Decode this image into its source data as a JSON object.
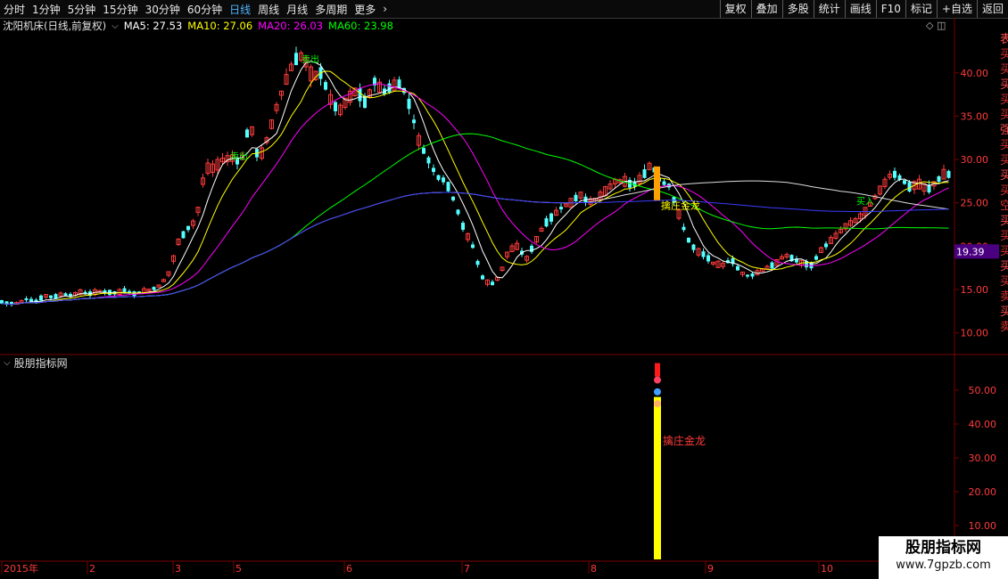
{
  "toolbar": {
    "periods": [
      "分时",
      "1分钟",
      "5分钟",
      "15分钟",
      "30分钟",
      "60分钟",
      "日线",
      "周线",
      "月线",
      "多周期",
      "更多"
    ],
    "active_index": 6,
    "more_arrow": "›",
    "actions": [
      "复权",
      "叠加",
      "多股",
      "统计",
      "画线",
      "F10",
      "标记",
      "+自选",
      "返回"
    ]
  },
  "info": {
    "stock_title": "沈阳机床(日线,前复权)",
    "ma5": "MA5: 27.53",
    "ma10": "MA10: 27.06",
    "ma20": "MA20: 26.03",
    "ma60": "MA60: 23.98",
    "icons": "◇ ◫"
  },
  "colors": {
    "up": "#ff3b3b",
    "down": "#54ffff",
    "ma5": "#ffffff",
    "ma10": "#ffff00",
    "ma20": "#ff00ff",
    "ma60": "#00ff00",
    "ma120": "#dcdcdc",
    "ma250": "#3b3bff",
    "grid": "#7a0000",
    "axis_text": "#ff3b3b",
    "price_tag_bg": "#4b0082"
  },
  "price_axis": {
    "ticks": [
      "40.00",
      "35.00",
      "30.00",
      "25.00",
      "20.00",
      "15.00",
      "10.00"
    ],
    "current_price": "19.39"
  },
  "annotations": {
    "sell_label": "卖出",
    "buy_label": "买入",
    "signal_label": "擒庄金龙"
  },
  "indicator": {
    "title": "股朋指标网",
    "ticks": [
      "50.00",
      "40.00",
      "30.00",
      "20.00",
      "10.00"
    ],
    "signal_label": "擒庄金龙"
  },
  "date_axis": {
    "labels": [
      "2015年",
      "2",
      "3",
      "5",
      "6",
      "7",
      "8",
      "9",
      "10"
    ]
  },
  "right_strip_text": [
    "表",
    "买",
    "买",
    "买",
    "买",
    "买",
    "强",
    "买",
    "买",
    "买",
    "买",
    "空",
    "买",
    "买",
    "买",
    "买",
    "买",
    "卖",
    "买",
    "卖"
  ],
  "watermark": {
    "line1": "股朋指标网",
    "line2": "www.7gpzb.com"
  },
  "chart_data": {
    "type": "candlestick",
    "price_range": [
      7.5,
      44.5
    ],
    "closing_trend": [
      [
        1,
        13.6
      ],
      [
        10,
        13.4
      ],
      [
        20,
        13.4
      ],
      [
        30,
        13.9
      ],
      [
        40,
        13.6
      ],
      [
        50,
        14.3
      ],
      [
        60,
        14.1
      ],
      [
        70,
        14.5
      ],
      [
        80,
        14.3
      ],
      [
        90,
        14.7
      ],
      [
        100,
        14.5
      ],
      [
        110,
        14.8
      ],
      [
        120,
        14.7
      ],
      [
        130,
        14.6
      ],
      [
        140,
        14.9
      ],
      [
        150,
        14.5
      ],
      [
        160,
        14.8
      ],
      [
        170,
        15.0
      ],
      [
        180,
        15.5
      ],
      [
        190,
        17.0
      ],
      [
        200,
        20.5
      ],
      [
        210,
        22.0
      ],
      [
        220,
        23.0
      ],
      [
        230,
        29.0
      ],
      [
        240,
        29.0
      ],
      [
        250,
        30.0
      ],
      [
        260,
        30.2
      ],
      [
        270,
        29.5
      ],
      [
        280,
        34.5
      ],
      [
        290,
        29.8
      ],
      [
        300,
        32.5
      ],
      [
        310,
        36.0
      ],
      [
        320,
        39.0
      ],
      [
        330,
        41.5
      ],
      [
        340,
        42.0
      ],
      [
        350,
        39.5
      ],
      [
        360,
        40.0
      ],
      [
        370,
        37.0
      ],
      [
        380,
        35.5
      ],
      [
        390,
        37.0
      ],
      [
        400,
        38.0
      ],
      [
        410,
        36.5
      ],
      [
        420,
        39.0
      ],
      [
        430,
        37.8
      ],
      [
        440,
        38.5
      ],
      [
        450,
        38.8
      ],
      [
        460,
        36.0
      ],
      [
        470,
        32.0
      ],
      [
        480,
        30.0
      ],
      [
        490,
        28.0
      ],
      [
        500,
        27.5
      ],
      [
        510,
        25.0
      ],
      [
        520,
        22.0
      ],
      [
        530,
        20.0
      ],
      [
        540,
        16.5
      ],
      [
        550,
        15.5
      ],
      [
        560,
        16.5
      ],
      [
        570,
        19.5
      ],
      [
        580,
        20.0
      ],
      [
        590,
        18.5
      ],
      [
        600,
        20.5
      ],
      [
        610,
        22.5
      ],
      [
        620,
        23.5
      ],
      [
        630,
        24.5
      ],
      [
        640,
        25.0
      ],
      [
        650,
        26.0
      ],
      [
        660,
        25.0
      ],
      [
        670,
        25.5
      ],
      [
        680,
        26.5
      ],
      [
        690,
        27.5
      ],
      [
        700,
        27.5
      ],
      [
        710,
        27.0
      ],
      [
        720,
        28.0
      ],
      [
        730,
        29.5
      ],
      [
        740,
        27.5
      ],
      [
        750,
        27.0
      ],
      [
        760,
        24.0
      ],
      [
        770,
        21.0
      ],
      [
        780,
        19.5
      ],
      [
        790,
        19.0
      ],
      [
        800,
        18.0
      ],
      [
        810,
        17.8
      ],
      [
        820,
        18.5
      ],
      [
        830,
        17.0
      ],
      [
        840,
        16.5
      ],
      [
        850,
        17.0
      ],
      [
        860,
        17.5
      ],
      [
        870,
        18.0
      ],
      [
        880,
        19.0
      ],
      [
        890,
        18.5
      ],
      [
        900,
        18.0
      ],
      [
        910,
        17.8
      ],
      [
        920,
        19.5
      ],
      [
        930,
        20.5
      ],
      [
        940,
        21.5
      ],
      [
        950,
        22.5
      ],
      [
        960,
        23.0
      ],
      [
        970,
        24.0
      ],
      [
        980,
        25.5
      ],
      [
        990,
        27.0
      ],
      [
        1000,
        28.5
      ],
      [
        1010,
        27.8
      ],
      [
        1020,
        26.8
      ],
      [
        1030,
        27.2
      ],
      [
        1040,
        26.5
      ],
      [
        1050,
        27.5
      ],
      [
        1060,
        28.5
      ],
      [
        1068,
        28.0
      ]
    ],
    "moving_averages": [
      {
        "name": "MA5",
        "value": 27.53
      },
      {
        "name": "MA10",
        "value": 27.06
      },
      {
        "name": "MA20",
        "value": 26.03
      },
      {
        "name": "MA60",
        "value": 23.98
      }
    ],
    "indicator_range": [
      0,
      60
    ],
    "signal_bar": {
      "label": "擒庄金龙",
      "value": 48
    }
  }
}
